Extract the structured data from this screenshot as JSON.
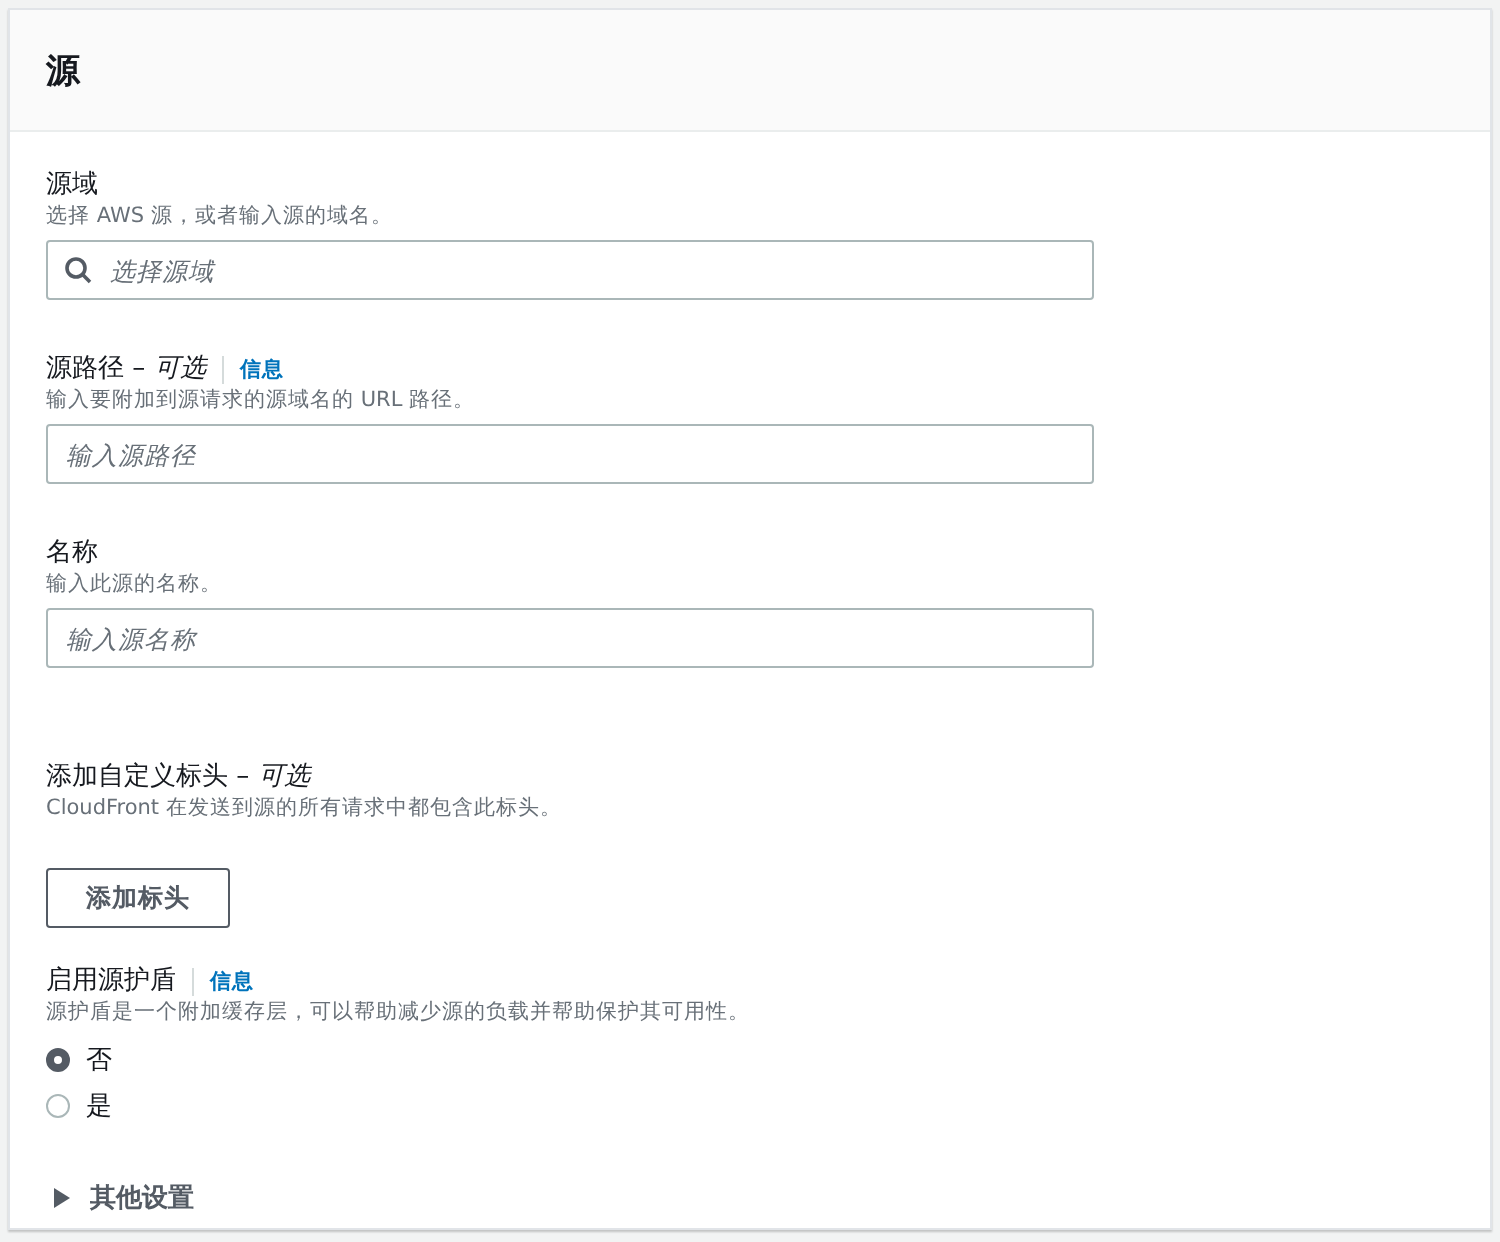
{
  "panel": {
    "title": "源"
  },
  "fields": [
    {
      "kind": "search",
      "label": "源域",
      "description": "选择 AWS 源，或者输入源的域名。",
      "placeholder": "选择源域"
    },
    {
      "kind": "text",
      "label": "源路径 – *可选*",
      "info": "信息",
      "description": "输入要附加到源请求的源域名的 URL 路径。",
      "placeholder": "输入源路径"
    },
    {
      "kind": "text",
      "label": "名称",
      "description": "输入此源的名称。",
      "placeholder": "输入源名称"
    }
  ],
  "custom_headers": {
    "label": "添加自定义标头 – *可选*",
    "description": "CloudFront 在发送到源的所有请求中都包含此标头。",
    "button": "添加标头"
  },
  "origin_shield": {
    "label": "启用源护盾",
    "info": "信息",
    "description": "源护盾是一个附加缓存层，可以帮助减少源的负载并帮助保护其可用性。",
    "options": [
      {
        "label": "否",
        "selected": true
      },
      {
        "label": "是",
        "selected": false
      }
    ]
  },
  "additional_settings": {
    "label": "其他设置",
    "expanded": false
  }
}
